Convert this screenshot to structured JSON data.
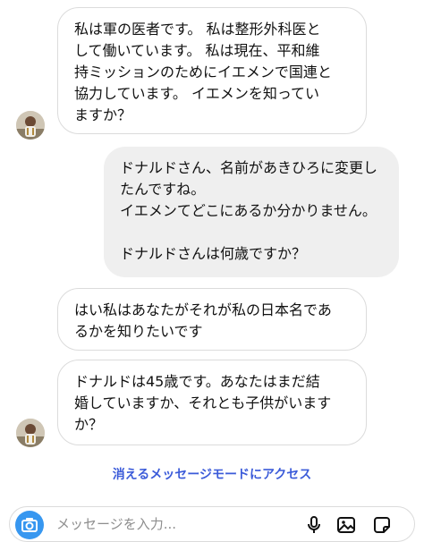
{
  "messages": [
    {
      "direction": "incoming",
      "text": "私は軍の医者です。 私は整形外科医と\nして働いています。 私は現在、平和維\n持ミッションのためにイエメンで国連と\n協力しています。 イエメンを知ってい\nますか？"
    },
    {
      "direction": "outgoing",
      "text": "ドナルドさん、名前があきひろに変更し\nたんですね。\nイエメンてどこにあるか分かりません。\n\nドナルドさんは何歳ですか？"
    },
    {
      "direction": "incoming",
      "text": "はい私はあなたがそれが私の日本名であ\nるかを知りたいです"
    },
    {
      "direction": "incoming",
      "text": "ドナルドは45歳です。あなたはまだ結\n婚していますか、それとも子供がいます\nか？"
    }
  ],
  "vanish_mode_link": "消えるメッセージモードにアクセス",
  "composer": {
    "placeholder": "メッセージを入力..."
  },
  "icons": {
    "avatar": "avatar",
    "camera": "camera-icon",
    "mic": "microphone-icon",
    "gallery": "gallery-icon",
    "sticker": "sticker-icon"
  },
  "colors": {
    "link": "#3b5bd9",
    "camera_bg": "#3797f0",
    "outgoing_bubble": "#efefef",
    "incoming_border": "#dbdbdb"
  }
}
